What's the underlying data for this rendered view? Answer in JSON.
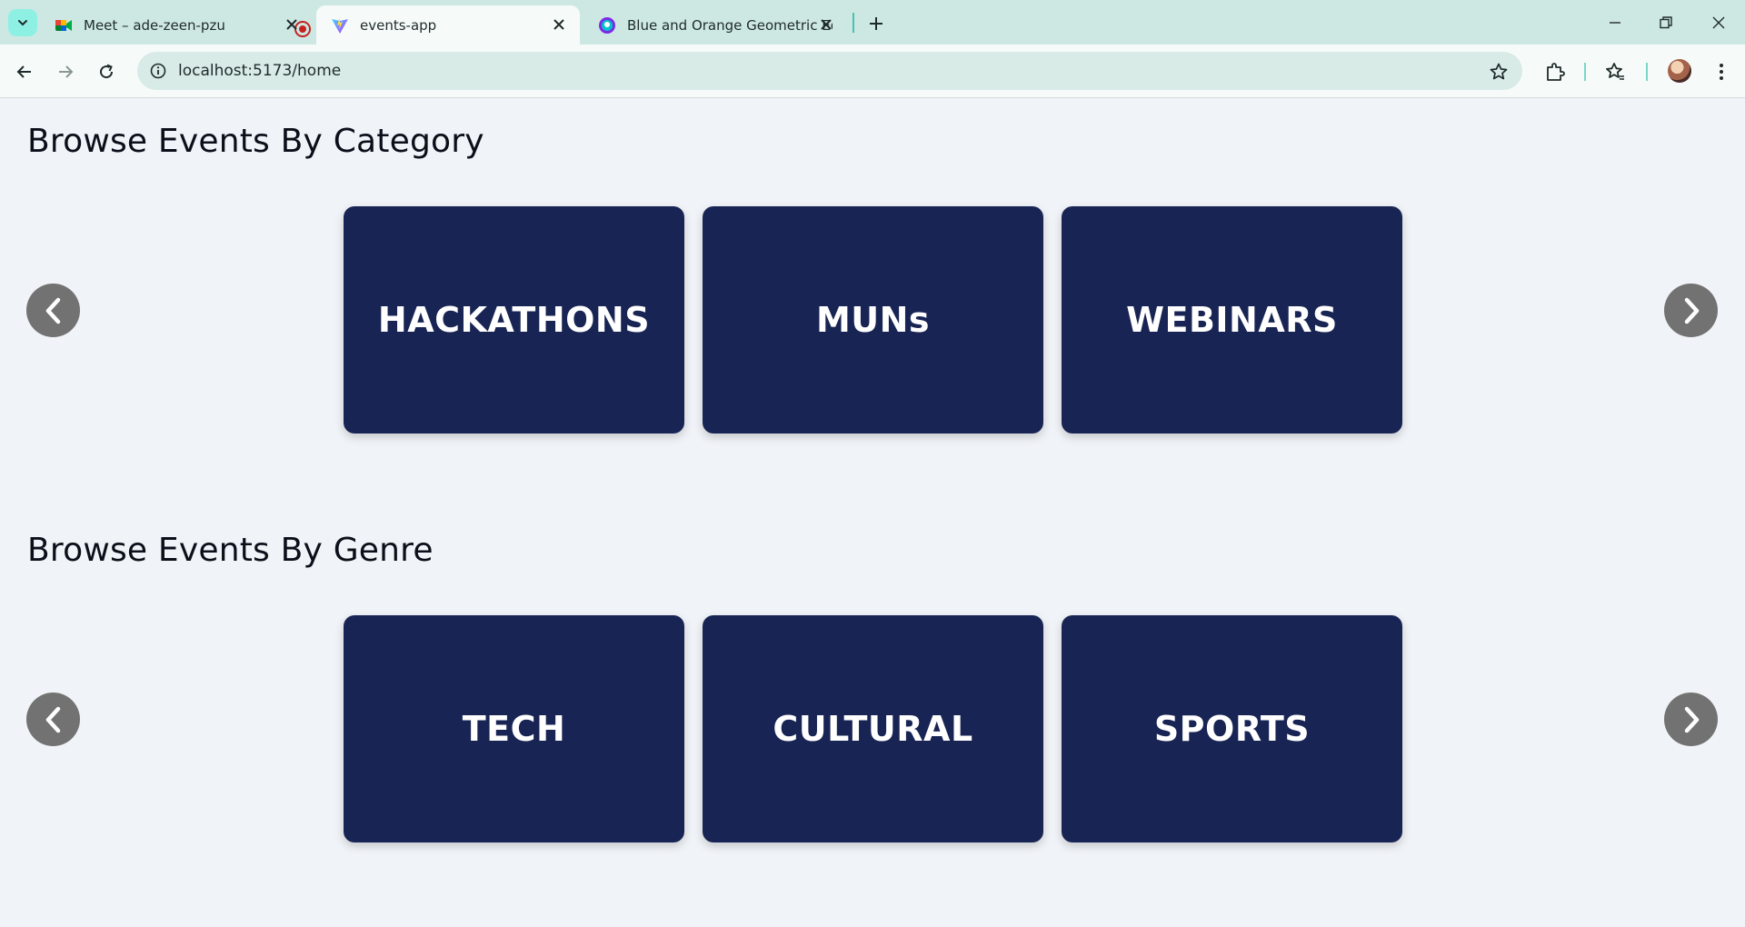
{
  "browser": {
    "tabs": [
      {
        "title": "Meet – ade-zeen-pzu",
        "icon": "google-meet-icon",
        "recording": true
      },
      {
        "title": "events-app",
        "icon": "vite-icon",
        "active": true
      },
      {
        "title": "Blue and Orange Geometric Edu",
        "icon": "canva-icon"
      }
    ],
    "url": "localhost:5173/home"
  },
  "page": {
    "category_section": {
      "title": "Browse Events By Category",
      "cards": [
        "HACKATHONS",
        "MUNs",
        "WEBINARS"
      ]
    },
    "genre_section": {
      "title": "Browse Events By Genre",
      "cards": [
        "TECH",
        "CULTURAL",
        "SPORTS"
      ]
    }
  },
  "colors": {
    "card_background": "#182453",
    "card_text": "#ffffff",
    "arrow_button": "#727272",
    "page_background": "#f0f3f7"
  }
}
